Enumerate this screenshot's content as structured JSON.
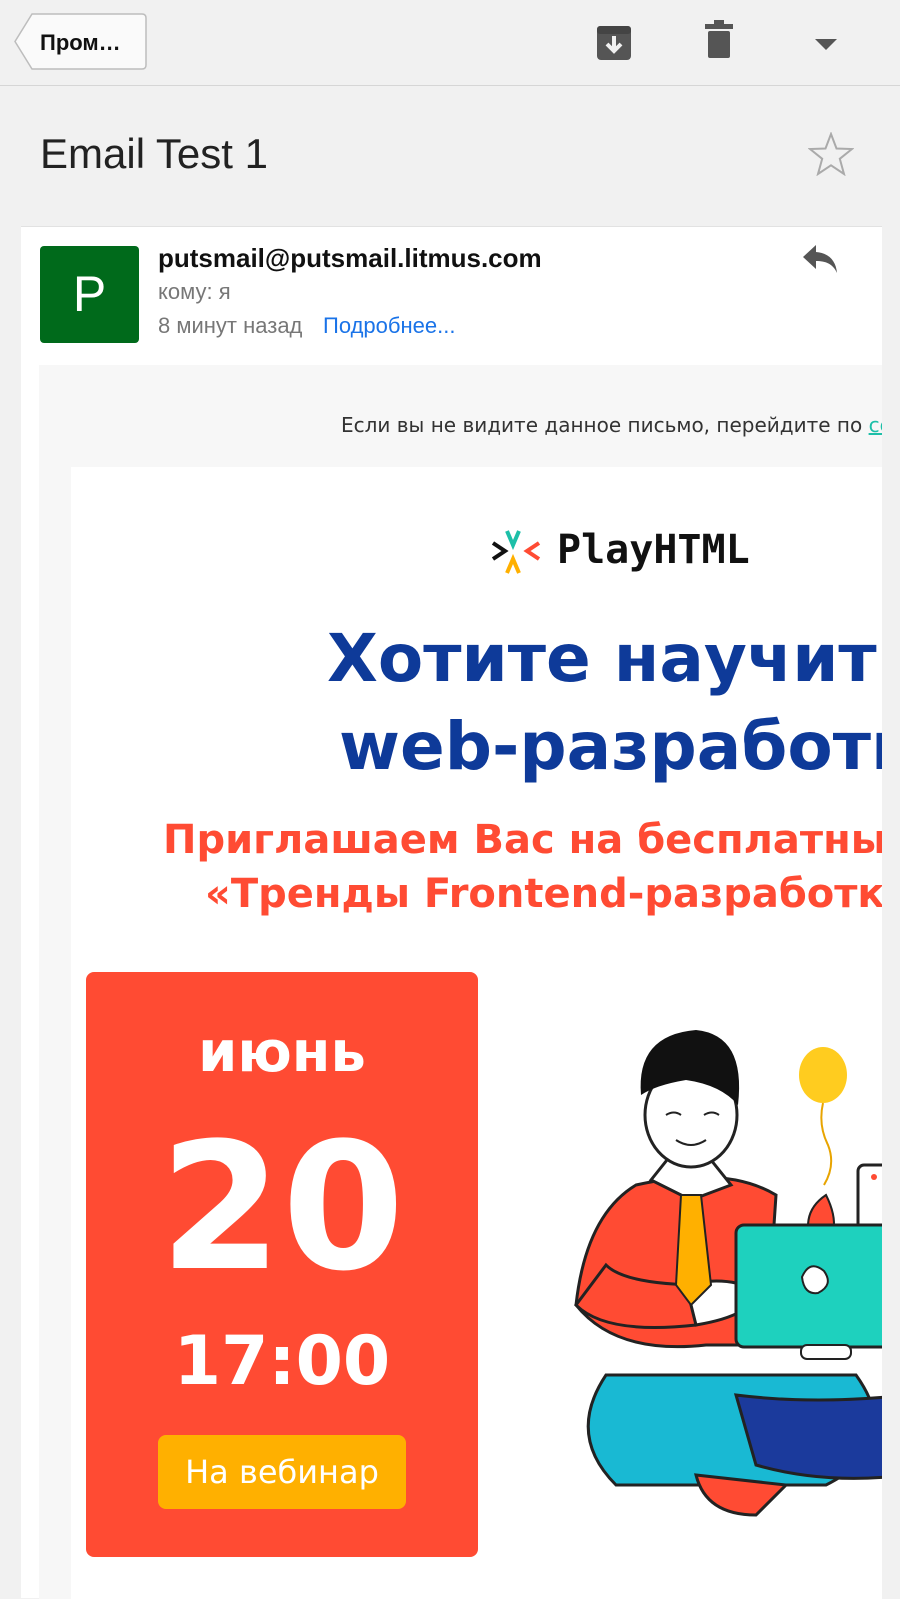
{
  "toolbar": {
    "back_label": "Пром…",
    "icons": [
      "archive-icon",
      "trash-icon",
      "dropdown-icon"
    ]
  },
  "subject": "Email Test 1",
  "message": {
    "avatar_letter": "P",
    "sender": "putsmail@putsmail.litmus.com",
    "to": "кому: я",
    "time": "8 минут назад",
    "details_link": "Подробнее..."
  },
  "email": {
    "preheader_text": "Если вы не видите данное письмо, перейдите по ",
    "preheader_link": "ссыл",
    "logo_text": "PlayHTML",
    "headline_line1": "Хотите научитьс",
    "headline_line2": "web-разработке",
    "subhead_line1": "Приглашаем Вас на бесплатный",
    "subhead_line2": "«Тренды Frontend-разработки",
    "month": "июнь",
    "day": "20",
    "time": "17:00",
    "cta_label": "На вебинар"
  },
  "colors": {
    "avatar_bg": "#006a1b",
    "link_blue": "#1a73e8",
    "headline_blue": "#0e3a99",
    "accent_red": "#ff4b33",
    "cta_yellow": "#ffb000",
    "preheader_link": "#1dbfa8"
  }
}
